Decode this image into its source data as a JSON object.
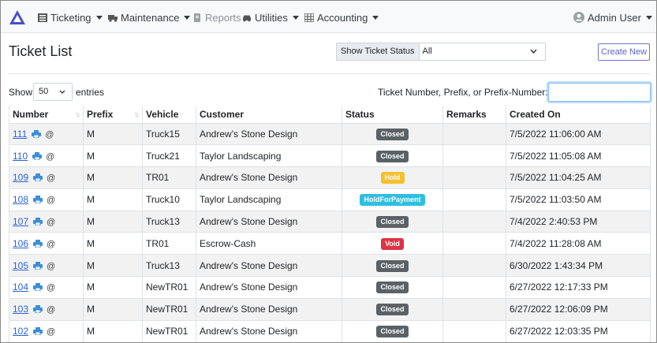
{
  "navbar": {
    "items": [
      {
        "label": "Ticketing",
        "icon": "list-icon",
        "dropdown": true
      },
      {
        "label": "Maintenance",
        "icon": "truck-icon",
        "dropdown": true
      },
      {
        "label": "Reports",
        "icon": "document-icon",
        "dropdown": false
      },
      {
        "label": "Utilities",
        "icon": "car-icon",
        "dropdown": true
      },
      {
        "label": "Accounting",
        "icon": "table-icon",
        "dropdown": true
      }
    ],
    "user": {
      "label": "Admin User",
      "icon": "avatar-icon"
    }
  },
  "page": {
    "title": "Ticket List",
    "status_filter_label": "Show Ticket Status",
    "status_filter_value": "All",
    "create_button": "Create New"
  },
  "controls": {
    "show_label": "Show",
    "entries_value": "50",
    "entries_label": "entries",
    "search_label": "Ticket Number, Prefix, or Prefix-Number:",
    "search_value": ""
  },
  "table": {
    "columns": [
      "Number",
      "Prefix",
      "Vehicle",
      "Customer",
      "Status",
      "Remarks",
      "Created On"
    ],
    "rows": [
      {
        "number": "111",
        "prefix": "M",
        "vehicle": "Truck15",
        "customer": "Andrew's Stone Design",
        "status": "Closed",
        "remarks": "",
        "created": "7/5/2022 11:06:00 AM"
      },
      {
        "number": "110",
        "prefix": "M",
        "vehicle": "Truck21",
        "customer": "Taylor Landscaping",
        "status": "Closed",
        "remarks": "",
        "created": "7/5/2022 11:05:08 AM"
      },
      {
        "number": "109",
        "prefix": "M",
        "vehicle": "TR01",
        "customer": "Andrew's Stone Design",
        "status": "Hold",
        "remarks": "",
        "created": "7/5/2022 11:04:25 AM"
      },
      {
        "number": "108",
        "prefix": "M",
        "vehicle": "Truck10",
        "customer": "Taylor Landscaping",
        "status": "HoldForPayment",
        "remarks": "",
        "created": "7/5/2022 11:03:50 AM"
      },
      {
        "number": "107",
        "prefix": "M",
        "vehicle": "Truck13",
        "customer": "Andrew's Stone Design",
        "status": "Closed",
        "remarks": "",
        "created": "7/4/2022 2:40:53 PM"
      },
      {
        "number": "106",
        "prefix": "M",
        "vehicle": "TR01",
        "customer": "Escrow-Cash",
        "status": "Void",
        "remarks": "",
        "created": "7/4/2022 11:28:08 AM"
      },
      {
        "number": "105",
        "prefix": "M",
        "vehicle": "Truck13",
        "customer": "Andrew's Stone Design",
        "status": "Closed",
        "remarks": "",
        "created": "6/30/2022 1:43:34 PM"
      },
      {
        "number": "104",
        "prefix": "M",
        "vehicle": "NewTR01",
        "customer": "Andrew's Stone Design",
        "status": "Closed",
        "remarks": "",
        "created": "6/27/2022 12:17:33 PM"
      },
      {
        "number": "103",
        "prefix": "M",
        "vehicle": "NewTR01",
        "customer": "Andrew's Stone Design",
        "status": "Closed",
        "remarks": "",
        "created": "6/27/2022 12:06:09 PM"
      },
      {
        "number": "102",
        "prefix": "M",
        "vehicle": "NewTR01",
        "customer": "Andrew's Stone Design",
        "status": "Closed",
        "remarks": "",
        "created": "6/27/2022 12:03:35 PM"
      }
    ]
  },
  "status_colors": {
    "Closed": "#5a6268",
    "Hold": "#f5c02e",
    "HoldForPayment": "#2ebfe0",
    "Void": "#dc3545"
  },
  "colors": {
    "link": "#2b64d6",
    "accent": "#5b62d2",
    "logo": "#4a4fc7"
  }
}
